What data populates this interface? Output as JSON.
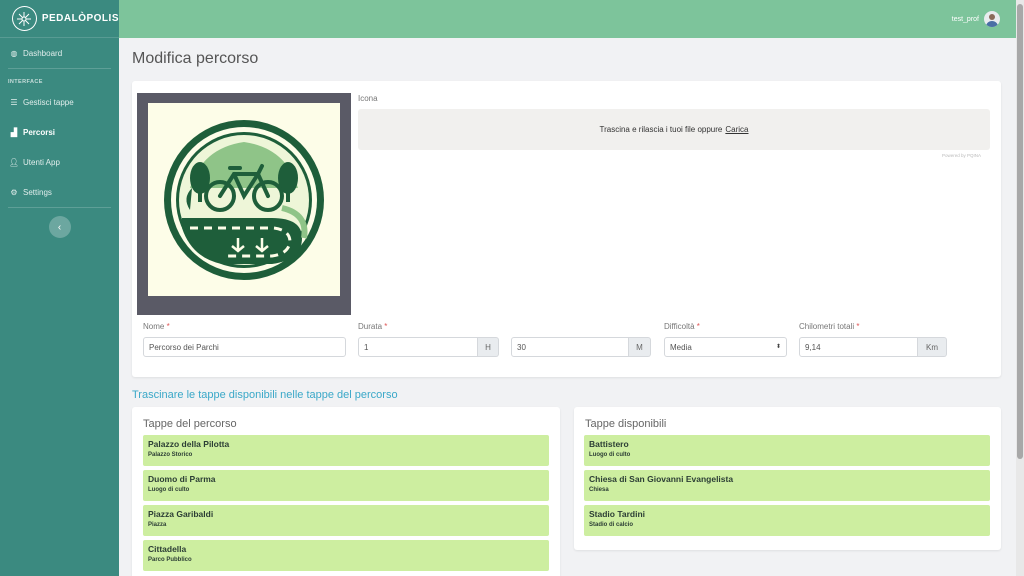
{
  "brand": {
    "name": "PEDALÒPOLIS"
  },
  "sidebar": {
    "dashboard": "Dashboard",
    "heading": "INTERFACE",
    "items": [
      "Gestisci tappe",
      "Percorsi",
      "Utenti App",
      "Settings"
    ]
  },
  "topbar": {
    "username": "test_prof"
  },
  "page": {
    "title": "Modifica percorso"
  },
  "form": {
    "icon_label": "Icona",
    "dropzone_text": "Trascina e rilascia i tuoi file oppure",
    "dropzone_link": "Carica",
    "powered": "Powered by PQINA",
    "nome_label": "Nome",
    "nome_value": "Percorso dei Parchi",
    "durata_label": "Durata",
    "durata_hours": "1",
    "durata_hours_unit": "H",
    "durata_minutes": "30",
    "durata_minutes_unit": "M",
    "difficolta_label": "Difficoltà",
    "difficolta_value": "Media",
    "km_label": "Chilometri totali",
    "km_value": "9,14",
    "km_unit": "Km",
    "required_mark": "*"
  },
  "section": {
    "title": "Trascinare le tappe disponibili nelle tappe del percorso"
  },
  "tappe_percorso": {
    "title": "Tappe del percorso",
    "items": [
      {
        "name": "Palazzo della Pilotta",
        "type": "Palazzo Storico"
      },
      {
        "name": "Duomo di Parma",
        "type": "Luogo di culto"
      },
      {
        "name": "Piazza Garibaldi",
        "type": "Piazza"
      },
      {
        "name": "Cittadella",
        "type": "Parco Pubblico"
      }
    ]
  },
  "tappe_disponibili": {
    "title": "Tappe disponibili",
    "items": [
      {
        "name": "Battistero",
        "type": "Luogo di culto"
      },
      {
        "name": "Chiesa di San Giovanni Evangelista",
        "type": "Chiesa"
      },
      {
        "name": "Stadio Tardini",
        "type": "Stadio di calcio"
      }
    ]
  },
  "colors": {
    "sidebar": "#3b8a80",
    "topbar": "#7dc49b",
    "tappa": "#cdeea0",
    "accent": "#3aa8c8"
  }
}
